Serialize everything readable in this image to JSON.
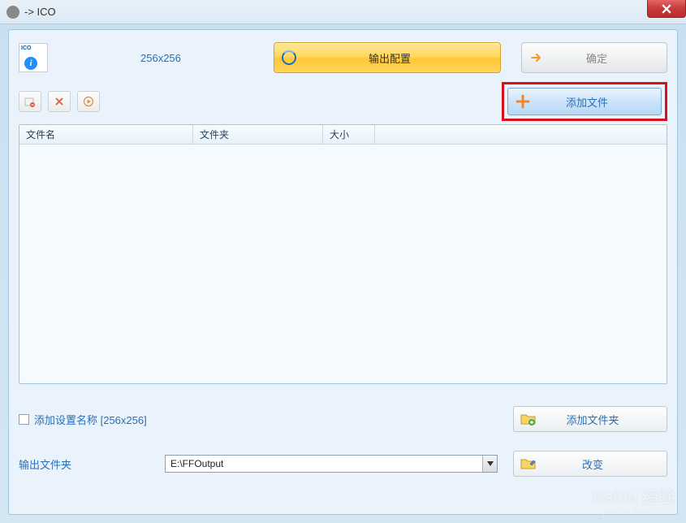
{
  "window": {
    "title": "-> ICO"
  },
  "preview": {
    "format_label": "ICO",
    "dimensions": "256x256"
  },
  "buttons": {
    "output_config": "输出配置",
    "confirm": "确定",
    "add_file": "添加文件",
    "add_folder": "添加文件夹",
    "change": "改变"
  },
  "table": {
    "columns": {
      "filename": "文件名",
      "folder": "文件夹",
      "size": "大小"
    },
    "rows": []
  },
  "settings": {
    "add_name_checkbox_label": "添加设置名称 [256x256]",
    "add_name_checked": false,
    "output_folder_label": "输出文件夹",
    "output_folder_value": "E:\\FFOutput"
  },
  "watermark": {
    "main": "Baidu 经验",
    "sub": "jingyan.baidu.com"
  }
}
